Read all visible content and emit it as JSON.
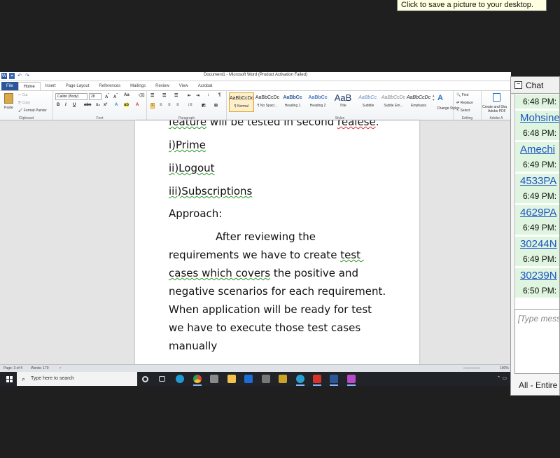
{
  "tooltip": "Click to save a picture to your desktop.",
  "word": {
    "title": "Document1  -  Microsoft Word (Product Activation Failed)",
    "tabs": [
      "File",
      "Home",
      "Insert",
      "Page Layout",
      "References",
      "Mailings",
      "Review",
      "View",
      "Acrobat"
    ],
    "active_tab": "Home",
    "clipboard": {
      "paste": "Paste",
      "cut": "Cut",
      "copy": "Copy",
      "format_painter": "Format Painter",
      "label": "Clipboard"
    },
    "font": {
      "name": "Calibri (Body)",
      "size": "28",
      "label": "Font"
    },
    "paragraph_label": "Paragraph",
    "styles": [
      {
        "preview": "AaBbCcDc",
        "name": "¶ Normal",
        "selected": true
      },
      {
        "preview": "AaBbCcDc",
        "name": "¶ No Spaci..."
      },
      {
        "preview": "AaBbCc",
        "name": "Heading 1"
      },
      {
        "preview": "AaBbCc",
        "name": "Heading 2"
      },
      {
        "preview": "AaB",
        "name": "Title"
      },
      {
        "preview": "AaBbCc.",
        "name": "Subtitle"
      },
      {
        "preview": "AaBbCcDc",
        "name": "Subtle Em..."
      },
      {
        "preview": "AaBbCcDc",
        "name": "Emphasis"
      }
    ],
    "styles_label": "Styles",
    "change_styles": "Change Styles",
    "editing": {
      "find": "Find",
      "replace": "Replace",
      "select": "Select",
      "label": "Editing"
    },
    "adobe": {
      "line1": "Create and Sha",
      "line2": "Adobe PDF",
      "label": "Adobe A"
    },
    "document": {
      "line0": "feature will be tested in second realese.",
      "items": [
        "i)Prime",
        "ii)Logout",
        "iii)Subscriptions"
      ],
      "approach": "Approach:",
      "para": [
        "After reviewing the",
        "requirements  we have to create test",
        "cases which covers the positive and",
        "negative scenarios for each requirement.",
        "When application will be ready for test",
        "we have to execute those test cases",
        "manually"
      ]
    },
    "status": {
      "page": "Page: 3 of 4",
      "words": "Words: 179",
      "zoom": "100%"
    }
  },
  "taskbar": {
    "search_placeholder": "Type here to search",
    "icons": [
      {
        "name": "cortana",
        "color": "#202327"
      },
      {
        "name": "task-view",
        "color": "#202327"
      },
      {
        "name": "edge",
        "color": "#1f9ad6"
      },
      {
        "name": "chrome",
        "color": "#e2453c"
      },
      {
        "name": "store",
        "color": "#8a8a8a"
      },
      {
        "name": "file-explorer",
        "color": "#f2c14e"
      },
      {
        "name": "mail",
        "color": "#1c6ed6"
      },
      {
        "name": "media",
        "color": "#777777"
      },
      {
        "name": "snipping-tool",
        "color": "#c9a227"
      },
      {
        "name": "photos",
        "color": "#25a0d0"
      },
      {
        "name": "app-red",
        "color": "#d9312b"
      },
      {
        "name": "word",
        "color": "#2b579a"
      },
      {
        "name": "app-pink",
        "color": "#b84ac8"
      }
    ]
  },
  "chat": {
    "title": "Chat",
    "messages": [
      {
        "name": "",
        "time": "6:48 PM:"
      },
      {
        "name": "Mohsine",
        "time": "6:48 PM:"
      },
      {
        "name": "Amechi",
        "time": "6:49 PM:"
      },
      {
        "name": "4533PA",
        "time": "6:49 PM:"
      },
      {
        "name": "4629PA",
        "time": "6:49 PM:"
      },
      {
        "name": "30244N",
        "time": "6:49 PM:"
      },
      {
        "name": "30239N",
        "time": "6:50 PM:"
      }
    ],
    "placeholder": "[Type mess",
    "recipient": "All - Entire"
  }
}
